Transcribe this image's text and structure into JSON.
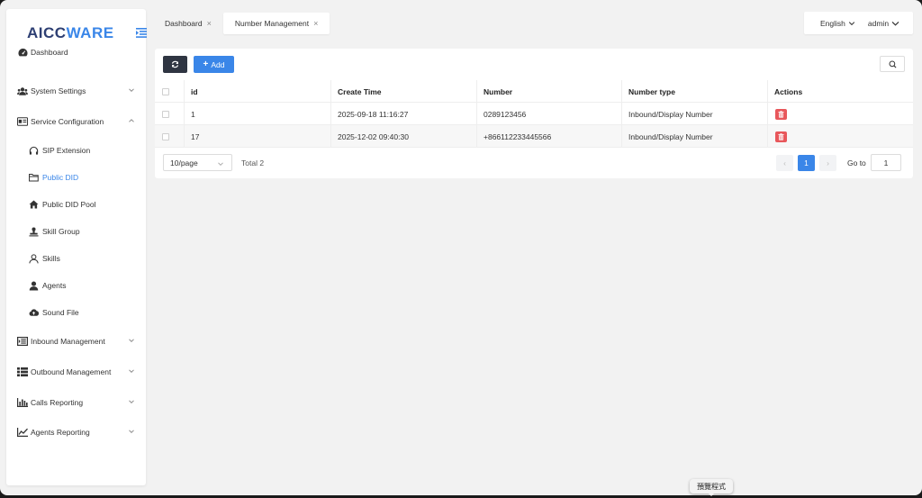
{
  "app": {
    "logo_main": "AICC",
    "logo_accent": "WARE"
  },
  "sidebar": {
    "items": [
      {
        "label": "Dashboard",
        "icon": "dashboard-icon"
      },
      {
        "label": "System Settings",
        "icon": "users-icon",
        "expandable": true
      },
      {
        "label": "Service Configuration",
        "icon": "id-card-icon",
        "expandable": true,
        "expanded": true
      }
    ],
    "sub_items": [
      {
        "label": "SIP Extension",
        "icon": "headset-icon"
      },
      {
        "label": "Public DID",
        "icon": "folder-icon",
        "active": true
      },
      {
        "label": "Public DID Pool",
        "icon": "home-icon"
      },
      {
        "label": "Skill Group",
        "icon": "stamp-icon"
      },
      {
        "label": "Skills",
        "icon": "user-outline-icon"
      },
      {
        "label": "Agents",
        "icon": "user-icon"
      },
      {
        "label": "Sound File",
        "icon": "cloud-upload-icon"
      }
    ],
    "bottom_items": [
      {
        "label": "Inbound Management",
        "icon": "indent-icon"
      },
      {
        "label": "Outbound Management",
        "icon": "list-icon"
      },
      {
        "label": "Calls Reporting",
        "icon": "bar-chart-icon"
      },
      {
        "label": "Agents Reporting",
        "icon": "line-chart-icon"
      }
    ]
  },
  "tabs": [
    {
      "label": "Dashboard",
      "close": "×",
      "active": false
    },
    {
      "label": "Number Management",
      "close": "×",
      "active": true
    }
  ],
  "header": {
    "language": "English",
    "user": "admin"
  },
  "toolbar": {
    "add_label": "Add"
  },
  "table": {
    "columns": [
      "id",
      "Create Time",
      "Number",
      "Number type",
      "Actions"
    ],
    "rows": [
      {
        "id": "1",
        "create_time": "2025-09-18 11:16:27",
        "number": "0289123456",
        "number_type": "Inbound/Display Number"
      },
      {
        "id": "17",
        "create_time": "2025-12-02 09:40:30",
        "number": "+866112233445566",
        "number_type": "Inbound/Display Number"
      }
    ]
  },
  "pagination": {
    "page_size": "10/page",
    "total": "Total 2",
    "current_page": "1",
    "goto_label": "Go to",
    "goto_value": "1",
    "prev": "‹",
    "next": "›"
  },
  "dock": {
    "tooltip": "預覽程式"
  },
  "colors": {
    "accent": "#3a86e8",
    "logo": "#2e3f73",
    "danger": "#e8575b",
    "dark_button": "#2f3542"
  }
}
